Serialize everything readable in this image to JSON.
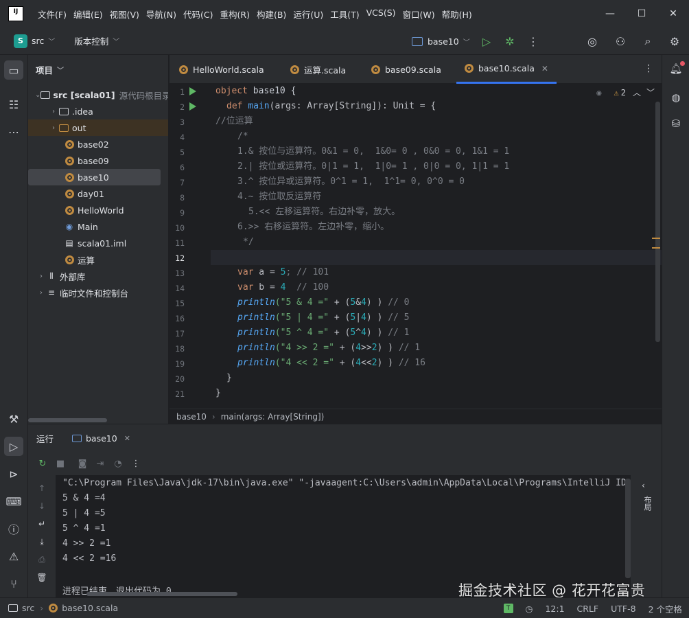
{
  "app": {
    "logo_text": "IJ",
    "menu": [
      "文件(F)",
      "编辑(E)",
      "视图(V)",
      "导航(N)",
      "代码(C)",
      "重构(R)",
      "构建(B)",
      "运行(U)",
      "工具(T)",
      "VCS(S)",
      "窗口(W)",
      "帮助(H)"
    ]
  },
  "toolbar": {
    "project_badge": "S",
    "project_name": "src",
    "vcs_label": "版本控制",
    "run_config": "base10"
  },
  "project_panel": {
    "title": "项目",
    "tree": [
      {
        "label": "src [scala01]",
        "suffix": "源代码根目录"
      },
      {
        "label": ".idea"
      },
      {
        "label": "out"
      },
      {
        "label": "base02"
      },
      {
        "label": "base09"
      },
      {
        "label": "base10"
      },
      {
        "label": "day01"
      },
      {
        "label": "HelloWorld"
      },
      {
        "label": "Main"
      },
      {
        "label": "scala01.iml"
      },
      {
        "label": "运算"
      },
      {
        "label": "外部库"
      },
      {
        "label": "临时文件和控制台"
      }
    ]
  },
  "editor": {
    "tabs": [
      "HelloWorld.scala",
      "运算.scala",
      "base09.scala",
      "base10.scala"
    ],
    "active_tab": "base10.scala",
    "warnings": "2",
    "line_numbers": [
      "1",
      "2",
      "3",
      "4",
      "5",
      "6",
      "7",
      "8",
      "9",
      "10",
      "11",
      "12",
      "13",
      "14",
      "15",
      "16",
      "17",
      "18",
      "19",
      "20",
      "21"
    ],
    "code": {
      "l1_kw": "object",
      "l1_name": " base10 {",
      "l2_kw": "def",
      "l2_fn": "main",
      "l2_rest": "(args: Array[String]): Unit = {",
      "l3": "//位运算",
      "l4": "/*",
      "l5": "1.& 按位与运算符。0&1 = 0,  1&0= 0 , 0&0 = 0, 1&1 = 1",
      "l6": "2.| 按位或运算符。0|1 = 1,  1|0= 1 , 0|0 = 0, 1|1 = 1",
      "l7": "3.^ 按位异或运算符。0^1 = 1,  1^1= 0, 0^0 = 0",
      "l8": "4.~ 按位取反运算符",
      "l9": "5.<< 左移运算符。右边补零，放大。",
      "l10": "6.>> 右移运算符。左边补零，缩小。",
      "l11": "*/",
      "l13_kw": "var",
      "l13_a": " a = ",
      "l13_num": "5",
      "l13_cm": "; // 101",
      "l14_kw": "var",
      "l14_a": " b = ",
      "l14_num": "4",
      "l14_cm": "  // 100",
      "l15_fn": "println",
      "l15_str": "(\"5 & 4 =\"",
      "l15_op": " + (",
      "l15_n1": "5",
      "l15_mid": "&",
      "l15_n2": "4",
      "l15_end": ") ",
      "l15_cm": "// 0",
      "l16_fn": "println",
      "l16_str": "(\"5 | 4 =\"",
      "l16_op": " + (",
      "l16_n1": "5",
      "l16_mid": "|",
      "l16_n2": "4",
      "l16_end": ") ",
      "l16_cm": "// 5",
      "l17_fn": "println",
      "l17_str": "(\"5 ^ 4 =\"",
      "l17_op": " + (",
      "l17_n1": "5",
      "l17_mid": "^",
      "l17_n2": "4",
      "l17_end": ") ",
      "l17_cm": "// 1",
      "l18_fn": "println",
      "l18_str": "(\"4 >> 2 =\"",
      "l18_op": " + (",
      "l18_n1": "4",
      "l18_mid": ">>",
      "l18_n2": "2",
      "l18_end": ") ) ",
      "l18_cm": "// 1",
      "l19_fn": "println",
      "l19_str": "(\"4 << 2 =\"",
      "l19_op": " + (",
      "l19_n1": "4",
      "l19_mid": "<<",
      "l19_n2": "2",
      "l19_end": ") ) ",
      "l19_cm": "// 16",
      "l20": "}",
      "l21": "}"
    }
  },
  "breadcrumb": {
    "item1": "base10",
    "item2": "main(args: Array[String])"
  },
  "run_panel": {
    "title": "运行",
    "tab": "base10",
    "console": [
      "\"C:\\Program Files\\Java\\jdk-17\\bin\\java.exe\" \"-javaagent:C:\\Users\\admin\\AppData\\Local\\Programs\\IntelliJ ID",
      "5 & 4 =4",
      "5 | 4 =5",
      "5 ^ 4 =1",
      "4 >> 2 =1",
      "4 << 2 =16",
      "",
      "进程已结束，退出代码为 0"
    ],
    "side_label": "布局"
  },
  "watermark": "掘金技术社区 @ 花开花富贵",
  "statusbar": {
    "crumb1": "src",
    "crumb2": "base10.scala",
    "position": "12:1",
    "line_sep": "CRLF",
    "encoding": "UTF-8",
    "indent": "2 个空格"
  }
}
